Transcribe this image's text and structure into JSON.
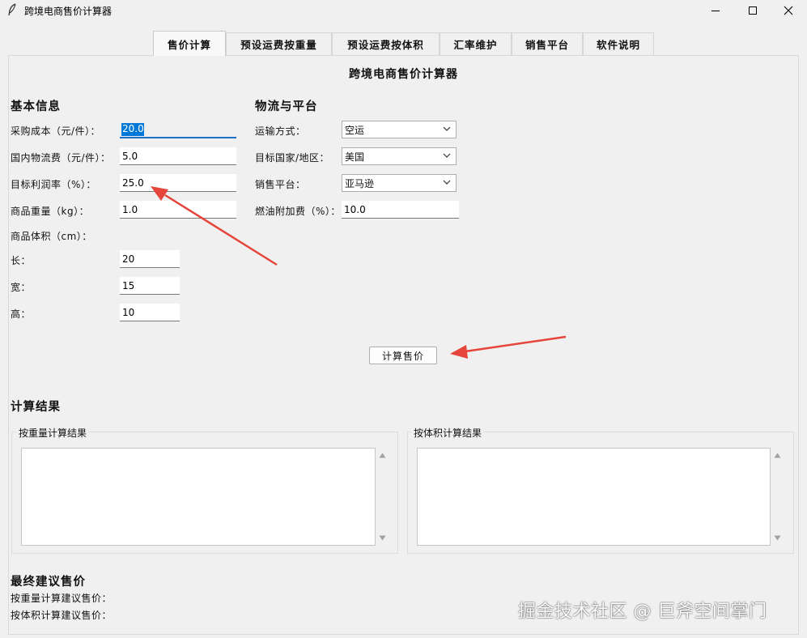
{
  "window": {
    "title": "跨境电商售价计算器",
    "icon": "feather-icon",
    "controls": [
      "minimize-icon",
      "maximize-icon",
      "close-icon"
    ]
  },
  "tabs": [
    {
      "label": "售价计算",
      "active": true
    },
    {
      "label": "预设运费按重量",
      "active": false
    },
    {
      "label": "预设运费按体积",
      "active": false
    },
    {
      "label": "汇率维护",
      "active": false
    },
    {
      "label": "销售平台",
      "active": false
    },
    {
      "label": "软件说明",
      "active": false
    }
  ],
  "heading": "跨境电商售价计算器",
  "basic": {
    "title": "基本信息",
    "purchase_cost": {
      "label": "采购成本（元/件）：",
      "value": "20.0"
    },
    "domestic_shipping": {
      "label": "国内物流费（元/件）：",
      "value": "5.0"
    },
    "profit_rate": {
      "label": "目标利润率（%）：",
      "value": "25.0"
    },
    "weight": {
      "label": "商品重量（kg）：",
      "value": "1.0"
    },
    "volume_label": "商品体积（cm）：",
    "length": {
      "label": "长：",
      "value": "20"
    },
    "width": {
      "label": "宽：",
      "value": "15"
    },
    "height": {
      "label": "高：",
      "value": "10"
    }
  },
  "logistics": {
    "title": "物流与平台",
    "transport": {
      "label": "运输方式：",
      "value": "空运"
    },
    "country": {
      "label": "目标国家/地区：",
      "value": "美国"
    },
    "platform": {
      "label": "销售平台：",
      "value": "亚马逊"
    },
    "fuel_surcharge": {
      "label": "燃油附加费（%）：",
      "value": "10.0"
    }
  },
  "calculate_button": "计算售价",
  "results": {
    "title": "计算结果",
    "by_weight_label": "按重量计算结果",
    "by_volume_label": "按体积计算结果",
    "by_weight_text": "",
    "by_volume_text": ""
  },
  "final": {
    "title": "最终建议售价",
    "by_weight": "按重量计算建议售价：",
    "by_volume": "按体积计算建议售价："
  },
  "watermark": "掘金技术社区 @ 巨斧空间掌门",
  "colors": {
    "background": "#f0f0f0",
    "selection": "#0078d7",
    "annotation_arrow": "#e5453a"
  }
}
